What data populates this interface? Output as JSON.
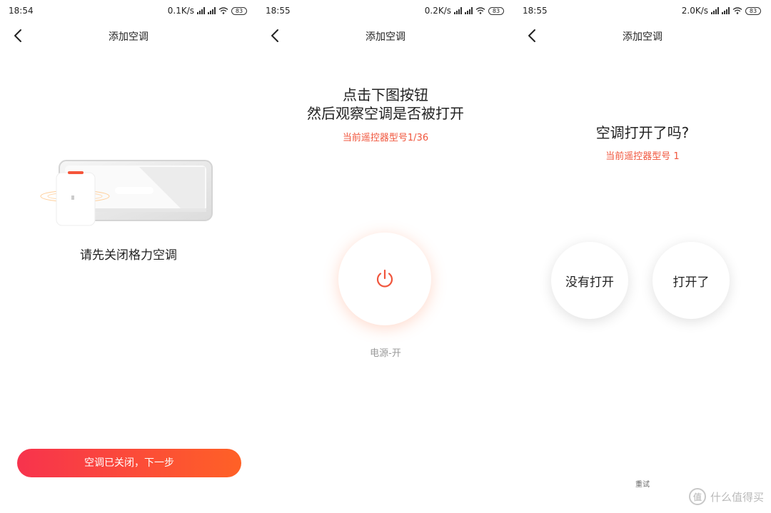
{
  "screens": [
    {
      "status": {
        "time": "18:54",
        "speed": "0.1K/s",
        "battery": "83"
      },
      "nav": {
        "title": "添加空调"
      },
      "caption": "请先关闭格力空调",
      "primary_button": "空调已关闭，下一步"
    },
    {
      "status": {
        "time": "18:55",
        "speed": "0.2K/s",
        "battery": "83"
      },
      "nav": {
        "title": "添加空调"
      },
      "title_line1": "点击下图按钮",
      "title_line2": "然后观察空调是否被打开",
      "remote_model": "当前遥控器型号1/36",
      "power_label": "电源-开"
    },
    {
      "status": {
        "time": "18:55",
        "speed": "2.0K/s",
        "battery": "83"
      },
      "nav": {
        "title": "添加空调"
      },
      "question": "空调打开了吗?",
      "remote_model": "当前遥控器型号 1",
      "no_button": "没有打开",
      "yes_button": "打开了",
      "retry": "重试"
    }
  ],
  "watermark": {
    "text": "什么值得买",
    "icon_glyph": "值"
  },
  "colors": {
    "accent": "#f0553c",
    "gradient_start": "#f7334d",
    "gradient_end": "#ff6126"
  },
  "icons": [
    "back-arrow-icon",
    "signal-icon",
    "wifi-icon",
    "battery-icon",
    "power-icon"
  ]
}
